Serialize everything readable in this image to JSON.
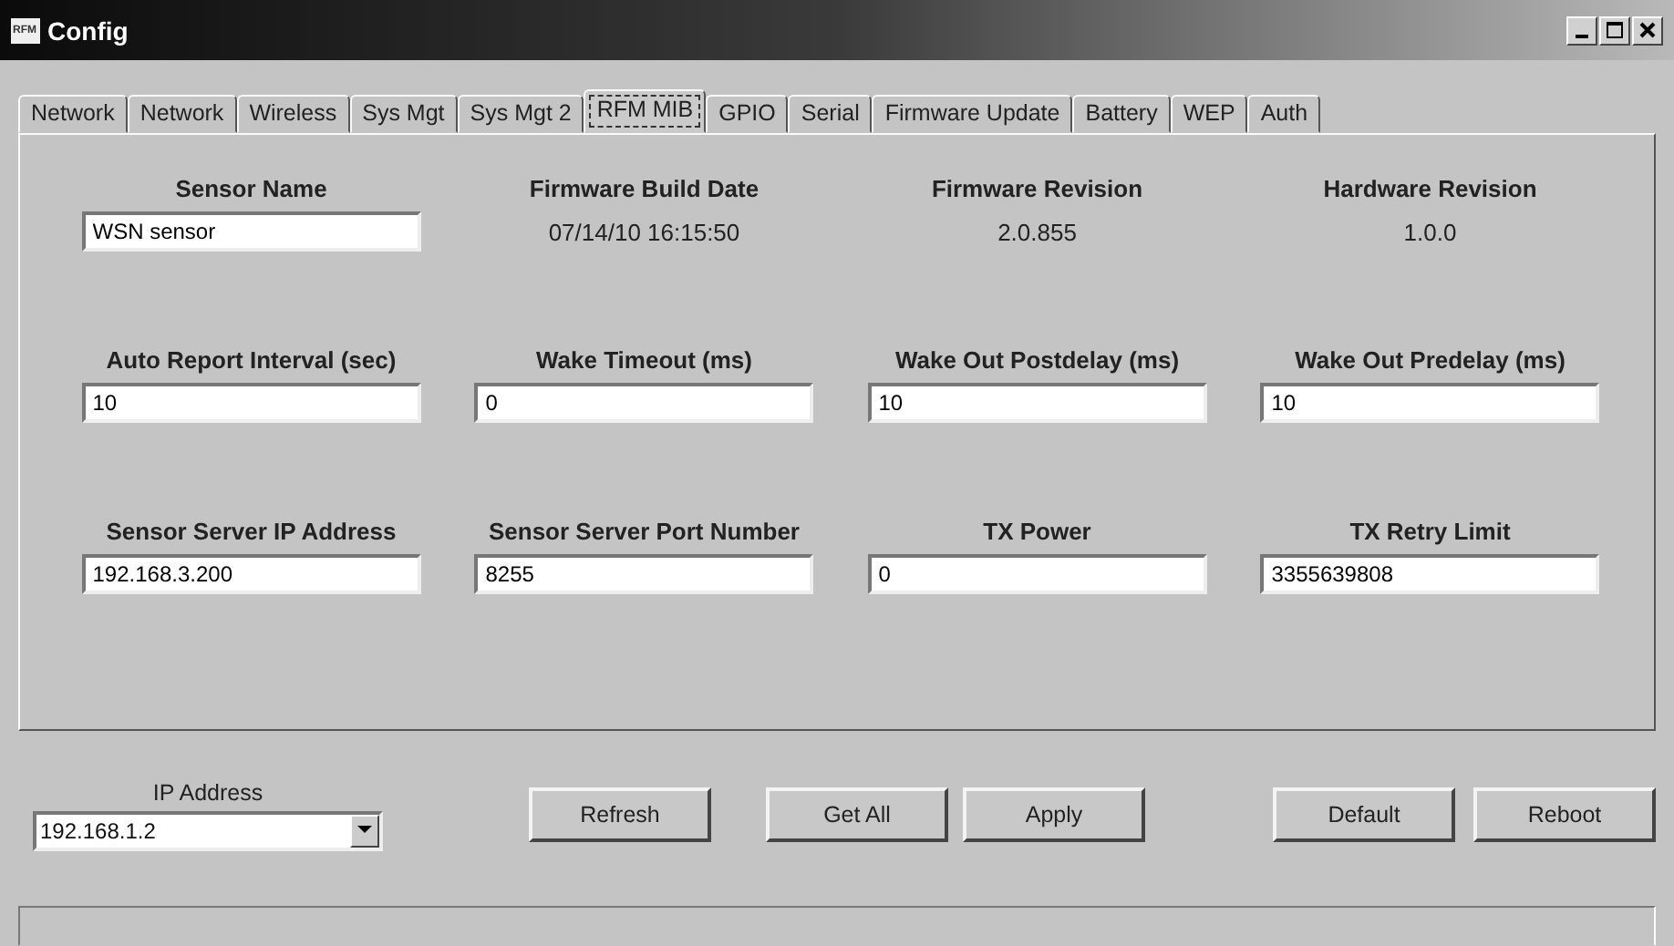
{
  "window": {
    "title": "Config",
    "logo": "RFM"
  },
  "tabs": [
    {
      "label": "Network",
      "selected": false
    },
    {
      "label": "Network",
      "selected": false
    },
    {
      "label": "Wireless",
      "selected": false
    },
    {
      "label": "Sys Mgt",
      "selected": false
    },
    {
      "label": "Sys Mgt 2",
      "selected": false
    },
    {
      "label": "RFM MIB",
      "selected": true
    },
    {
      "label": "GPIO",
      "selected": false
    },
    {
      "label": "Serial",
      "selected": false
    },
    {
      "label": "Firmware Update",
      "selected": false
    },
    {
      "label": "Battery",
      "selected": false
    },
    {
      "label": "WEP",
      "selected": false
    },
    {
      "label": "Auth",
      "selected": false
    }
  ],
  "fields": [
    {
      "label": "Sensor Name",
      "kind": "input",
      "value": "WSN sensor"
    },
    {
      "label": "Firmware Build Date",
      "kind": "value",
      "value": "07/14/10 16:15:50"
    },
    {
      "label": "Firmware Revision",
      "kind": "value",
      "value": "2.0.855"
    },
    {
      "label": "Hardware Revision",
      "kind": "value",
      "value": "1.0.0"
    },
    {
      "label": "Auto Report Interval (sec)",
      "kind": "input",
      "value": "10"
    },
    {
      "label": "Wake Timeout (ms)",
      "kind": "input",
      "value": "0"
    },
    {
      "label": "Wake Out Postdelay (ms)",
      "kind": "input",
      "value": "10"
    },
    {
      "label": "Wake Out Predelay (ms)",
      "kind": "input",
      "value": "10"
    },
    {
      "label": "Sensor Server IP Address",
      "kind": "input",
      "value": "192.168.3.200"
    },
    {
      "label": "Sensor Server Port Number",
      "kind": "input",
      "value": "8255"
    },
    {
      "label": "TX Power",
      "kind": "input",
      "value": "0"
    },
    {
      "label": "TX Retry Limit",
      "kind": "input",
      "value": "3355639808"
    }
  ],
  "ip_address": {
    "label": "IP Address",
    "value": "192.168.1.2"
  },
  "buttons": [
    "Refresh",
    "Get All",
    "Apply",
    "Default",
    "Reboot"
  ]
}
